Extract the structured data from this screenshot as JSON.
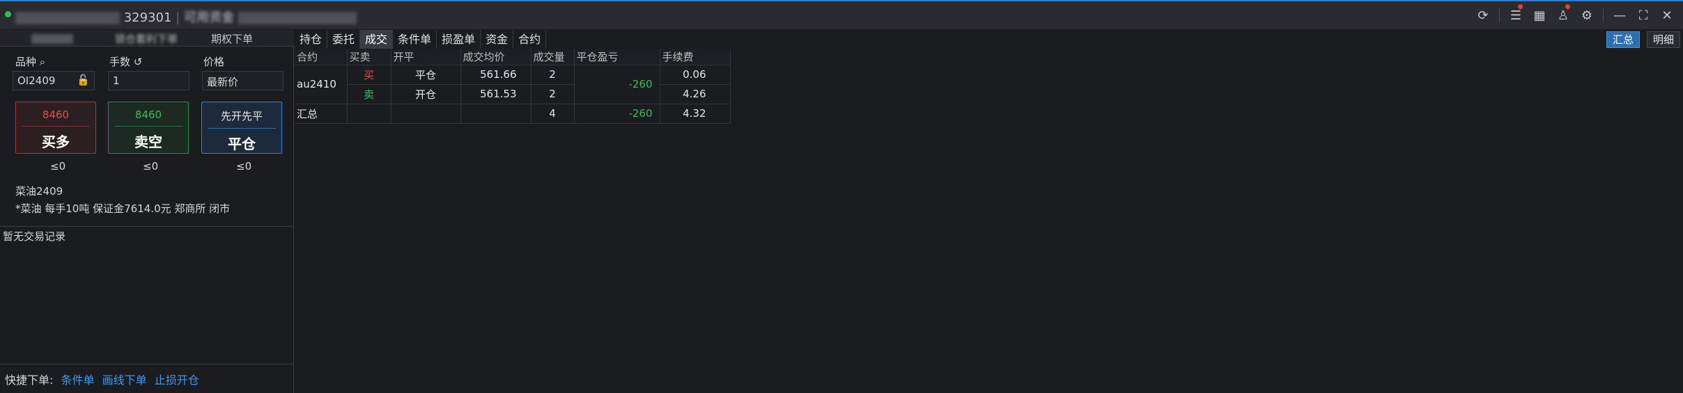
{
  "titlebar": {
    "account_suffix": "329301",
    "available_prefix": "可用资金"
  },
  "left_tabs": [
    "",
    "锁仓套利下单",
    "期权下单"
  ],
  "order": {
    "symbol_label": "品种",
    "qty_label": "手数",
    "price_label": "价格",
    "symbol_value": "OI2409",
    "qty_value": "1",
    "price_value": "最新价"
  },
  "buttons": {
    "buy": {
      "price": "8460",
      "label": "买多",
      "limit": "≤0"
    },
    "sell": {
      "price": "8460",
      "label": "卖空",
      "limit": "≤0"
    },
    "close": {
      "price": "先开先平",
      "label": "平仓",
      "limit": "≤0"
    }
  },
  "info": {
    "name": "菜油2409",
    "detail": "*菜油 每手10吨 保证金7614.0元 郑商所 闭市"
  },
  "no_record": "暂无交易记录",
  "quick": {
    "label": "快捷下单:",
    "links": [
      "条件单",
      "画线下单",
      "止损开仓"
    ]
  },
  "right_tabs": [
    "持仓",
    "委托",
    "成交",
    "条件单",
    "损盈单",
    "资金",
    "合约"
  ],
  "modes": [
    "汇总",
    "明细"
  ],
  "table": {
    "headers": [
      "合约",
      "买卖",
      "开平",
      "成交均价",
      "成交量",
      "平仓盈亏",
      "手续费"
    ],
    "contract": "au2410",
    "rows": [
      {
        "side": "买",
        "oc": "平仓",
        "avg": "561.66",
        "vol": "2",
        "fee": "0.06"
      },
      {
        "side": "卖",
        "oc": "开仓",
        "avg": "561.53",
        "vol": "2",
        "fee": "4.26"
      }
    ],
    "pnl": "-260",
    "total": {
      "label": "汇总",
      "vol": "4",
      "pnl": "-260",
      "fee": "4.32"
    }
  }
}
